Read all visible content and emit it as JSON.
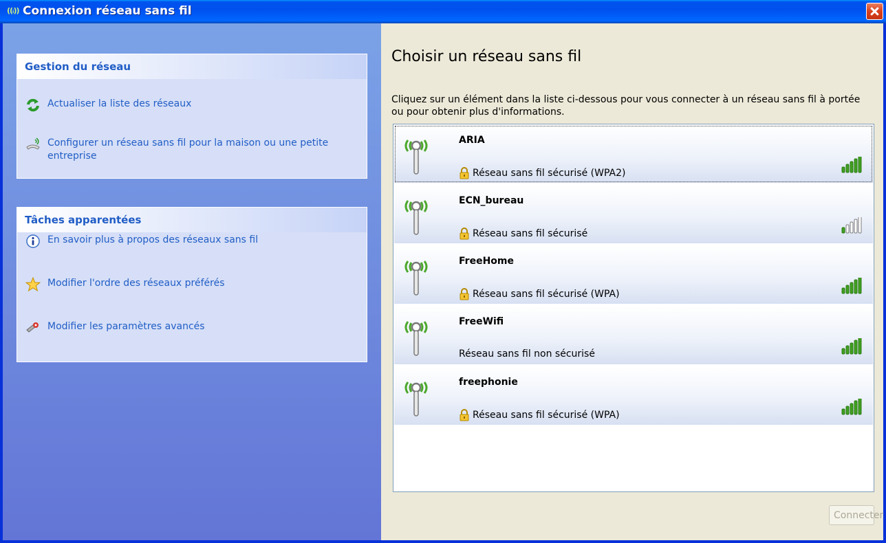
{
  "window": {
    "title": "Connexion réseau sans fil",
    "title_icon": "wifi-icon"
  },
  "colors": {
    "titlebar": "#0054e3",
    "sidebar": "#7ba2e7",
    "panel_background": "#d6dff7",
    "link": "#215dc6",
    "main_background": "#ece9d8",
    "signal_green": "#40a020",
    "close_button": "#d9411e"
  },
  "sidebar": {
    "network_tasks": {
      "header": "Gestion du réseau",
      "items": [
        {
          "label": "Actualiser la liste des réseaux",
          "icon": "refresh-icon"
        },
        {
          "label": "Configurer un réseau sans fil pour la maison ou une petite entreprise",
          "icon": "setup-wireless-icon"
        }
      ]
    },
    "related_tasks": {
      "header": "Tâches apparentées",
      "items": [
        {
          "label": "En savoir plus à propos des réseaux sans fil",
          "icon": "info-icon"
        },
        {
          "label": "Modifier l'ordre des réseaux préférés",
          "icon": "star-icon"
        },
        {
          "label": "Modifier les paramètres avancés",
          "icon": "settings-icon"
        }
      ]
    }
  },
  "main": {
    "title": "Choisir un réseau sans fil",
    "description": "Cliquez sur un élément dans la liste ci-dessous pour vous connecter à un réseau sans fil à portée ou pour obtenir plus d'informations.",
    "networks": [
      {
        "name": "ARIA",
        "status": "Réseau sans fil sécurisé (WPA2)",
        "secured": true,
        "signal_bars": 5,
        "selected": true
      },
      {
        "name": "ECN_bureau",
        "status": "Réseau sans fil sécurisé",
        "secured": true,
        "signal_bars": 1,
        "selected": false
      },
      {
        "name": "FreeHome",
        "status": "Réseau sans fil sécurisé (WPA)",
        "secured": true,
        "signal_bars": 5,
        "selected": false
      },
      {
        "name": "FreeWifi",
        "status": "Réseau sans fil non sécurisé",
        "secured": false,
        "signal_bars": 5,
        "selected": false
      },
      {
        "name": "freephonie",
        "status": "Réseau sans fil sécurisé (WPA)",
        "secured": true,
        "signal_bars": 5,
        "selected": false
      }
    ],
    "connect_label": "Connecter",
    "connect_enabled": false
  }
}
